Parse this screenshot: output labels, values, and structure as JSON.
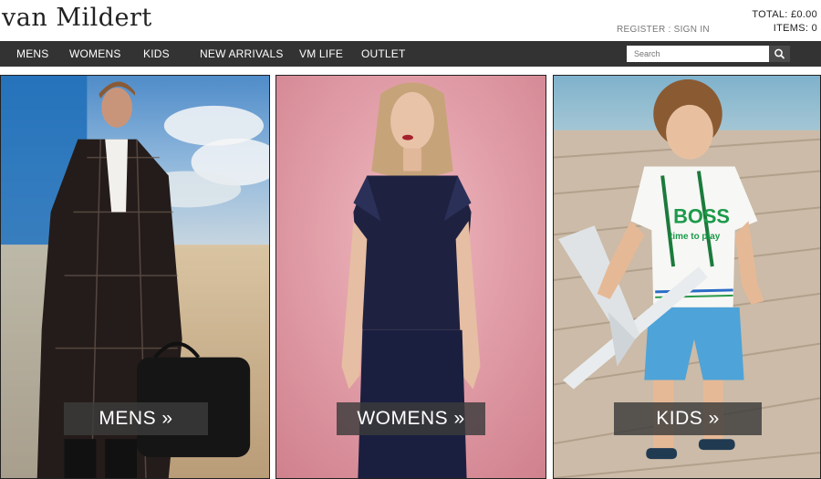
{
  "header": {
    "logo": "van Mildert",
    "register": "REGISTER",
    "separator": ":",
    "sign_in": "SIGN IN",
    "total": "TOTAL: £0.00",
    "items": "ITEMS: 0"
  },
  "nav": {
    "items": [
      "MENS",
      "WOMENS",
      "KIDS",
      "NEW ARRIVALS",
      "VM LIFE",
      "OUTLET"
    ]
  },
  "search": {
    "placeholder": "Search",
    "icon": "search-icon"
  },
  "panels": {
    "mens": {
      "label": "MENS »"
    },
    "womens": {
      "label": "WOMENS »"
    },
    "kids": {
      "label": "KIDS »"
    }
  },
  "graphic_text": {
    "shirt_brand": "BOSS",
    "shirt_slogan": "time to play"
  },
  "colors": {
    "nav_bg": "#333333",
    "mens_sky": "#6aa3d6",
    "womens_bg": "#e4a0a8",
    "kids_deck": "#c8b8a6"
  }
}
